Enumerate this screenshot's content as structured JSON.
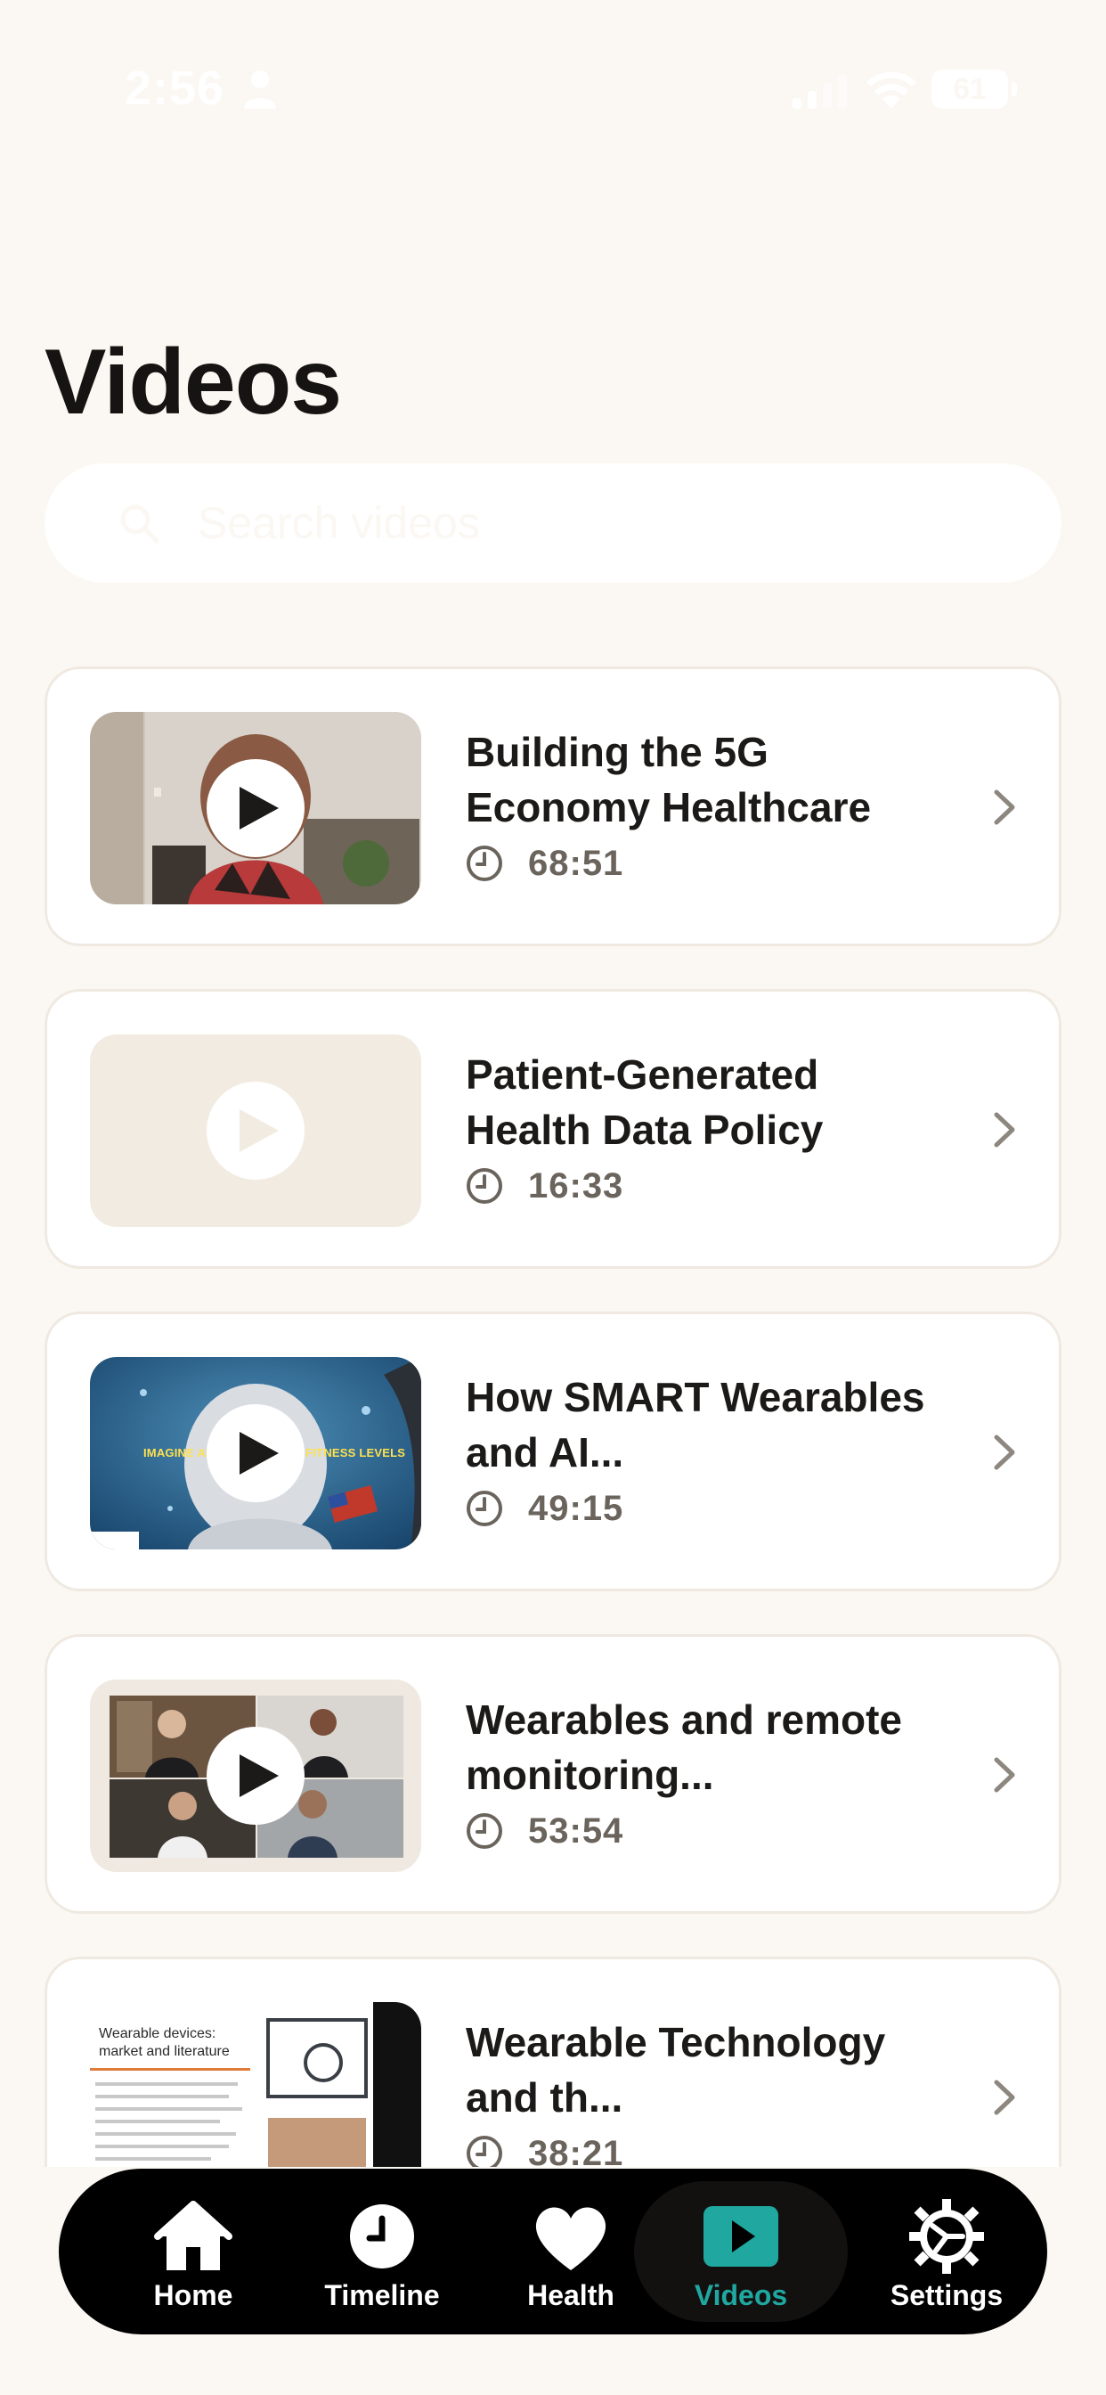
{
  "status_bar": {
    "time": "2:56",
    "battery": "61"
  },
  "page": {
    "title": "Videos"
  },
  "search": {
    "placeholder": "Search videos",
    "value": ""
  },
  "videos": [
    {
      "title": "Building the 5G Economy Healthcare",
      "duration": "68:51",
      "thumbnail": "woman-in-office"
    },
    {
      "title": "Patient-Generated Health Data Policy",
      "duration": "16:33",
      "thumbnail": "placeholder"
    },
    {
      "title": "How SMART Wearables and AI...",
      "duration": "49:15",
      "thumbnail": "astronaut"
    },
    {
      "title": "Wearables and remote monitoring...",
      "duration": "53:54",
      "thumbnail": "video-call-grid"
    },
    {
      "title": "Wearable Technology and th...",
      "duration": "38:21",
      "thumbnail": "slide-document"
    }
  ],
  "thumbnail_text": {
    "astronaut_caption": "IMAGINE AN ASTRONAUT'S FITNESS LEVELS",
    "slide_title": "Wearable devices: market and literature"
  },
  "tab_bar": {
    "tabs": [
      {
        "label": "Home",
        "icon": "house-icon"
      },
      {
        "label": "Timeline",
        "icon": "clock-icon"
      },
      {
        "label": "Health",
        "icon": "heart-icon"
      },
      {
        "label": "Videos",
        "icon": "play-square-icon"
      },
      {
        "label": "Settings",
        "icon": "gear-icon"
      }
    ],
    "active": "Videos"
  },
  "colors": {
    "background": "#fbf7f2",
    "card": "#ffffff",
    "accent": "#1fa7a0",
    "tab_bar": "#000000"
  }
}
